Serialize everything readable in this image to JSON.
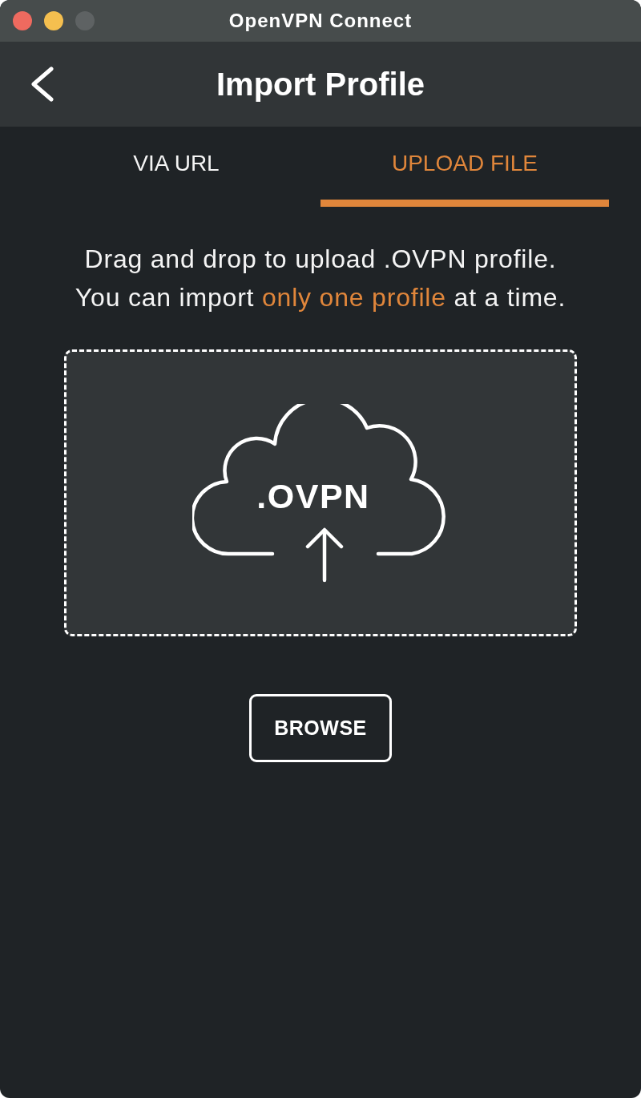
{
  "window": {
    "title": "OpenVPN Connect",
    "buttons": [
      {
        "kind": "close",
        "disabled": false
      },
      {
        "kind": "minimize",
        "disabled": false
      },
      {
        "kind": "zoom",
        "disabled": true
      }
    ]
  },
  "header": {
    "title": "Import Profile"
  },
  "tabs": [
    {
      "label": "VIA URL",
      "selected": false
    },
    {
      "label": "UPLOAD FILE",
      "selected": true
    }
  ],
  "instructions": [
    {
      "parts": [
        {
          "text": "Drag and drop to upload .OVPN profile.",
          "highlight": false
        }
      ]
    },
    {
      "parts": [
        {
          "text": "You can import ",
          "highlight": false
        },
        {
          "text": "only one profile",
          "highlight": true
        },
        {
          "text": " at a time.",
          "highlight": false
        }
      ]
    }
  ],
  "drop_zone": {
    "label": ".OVPN"
  },
  "browse_button": {
    "label": "BROWSE"
  }
}
